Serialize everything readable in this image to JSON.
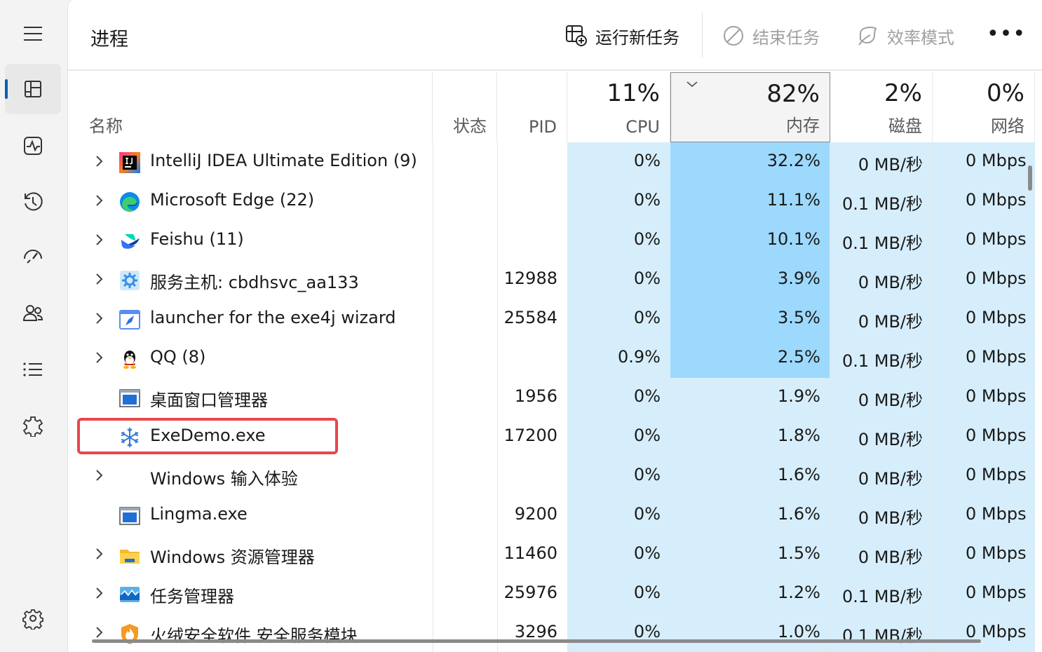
{
  "header": {
    "title": "进程",
    "run_task": "运行新任务",
    "end_task": "结束任务",
    "efficiency": "效率模式",
    "more": "•••"
  },
  "columns": {
    "name": "名称",
    "status": "状态",
    "pid": "PID",
    "cpu": {
      "pct": "11%",
      "label": "CPU"
    },
    "memory": {
      "pct": "82%",
      "label": "内存"
    },
    "disk": {
      "pct": "2%",
      "label": "磁盘"
    },
    "network": {
      "pct": "0%",
      "label": "网络"
    }
  },
  "nav_icons": [
    "menu-icon",
    "processes-icon",
    "performance-icon",
    "app-history-icon",
    "startup-apps-icon",
    "users-icon",
    "details-icon",
    "services-icon",
    "settings-icon"
  ],
  "rows": [
    {
      "name": "IntelliJ IDEA Ultimate Edition (9)",
      "pid": "",
      "cpu": "0%",
      "mem": "32.2%",
      "disk": "0 MB/秒",
      "net": "0 Mbps",
      "expand": true,
      "icon": "intellij-icon",
      "mem_level": "high"
    },
    {
      "name": "Microsoft Edge (22)",
      "pid": "",
      "cpu": "0%",
      "mem": "11.1%",
      "disk": "0.1 MB/秒",
      "net": "0 Mbps",
      "expand": true,
      "icon": "edge-icon",
      "mem_level": "high"
    },
    {
      "name": "Feishu (11)",
      "pid": "",
      "cpu": "0%",
      "mem": "10.1%",
      "disk": "0.1 MB/秒",
      "net": "0 Mbps",
      "expand": true,
      "icon": "feishu-icon",
      "mem_level": "high"
    },
    {
      "name": "服务主机: cbdhsvc_aa133",
      "pid": "12988",
      "cpu": "0%",
      "mem": "3.9%",
      "disk": "0 MB/秒",
      "net": "0 Mbps",
      "expand": true,
      "icon": "service-host-icon",
      "mem_level": "high"
    },
    {
      "name": "launcher for the exe4j wizard",
      "pid": "25584",
      "cpu": "0%",
      "mem": "3.5%",
      "disk": "0 MB/秒",
      "net": "0 Mbps",
      "expand": true,
      "icon": "launcher-icon",
      "mem_level": "high"
    },
    {
      "name": "QQ (8)",
      "pid": "",
      "cpu": "0.9%",
      "mem": "2.5%",
      "disk": "0.1 MB/秒",
      "net": "0 Mbps",
      "expand": true,
      "icon": "qq-icon",
      "mem_level": "high"
    },
    {
      "name": "桌面窗口管理器",
      "pid": "1956",
      "cpu": "0%",
      "mem": "1.9%",
      "disk": "0 MB/秒",
      "net": "0 Mbps",
      "expand": false,
      "icon": "window-icon",
      "mem_level": "low"
    },
    {
      "name": "ExeDemo.exe",
      "pid": "17200",
      "cpu": "0%",
      "mem": "1.8%",
      "disk": "0 MB/秒",
      "net": "0 Mbps",
      "expand": false,
      "icon": "snowflake-icon",
      "mem_level": "low"
    },
    {
      "name": "Windows 输入体验",
      "pid": "",
      "cpu": "0%",
      "mem": "1.6%",
      "disk": "0 MB/秒",
      "net": "0 Mbps",
      "expand": true,
      "icon": "",
      "mem_level": "low"
    },
    {
      "name": "Lingma.exe",
      "pid": "9200",
      "cpu": "0%",
      "mem": "1.6%",
      "disk": "0 MB/秒",
      "net": "0 Mbps",
      "expand": false,
      "icon": "window-icon",
      "mem_level": "low"
    },
    {
      "name": "Windows 资源管理器",
      "pid": "11460",
      "cpu": "0%",
      "mem": "1.5%",
      "disk": "0 MB/秒",
      "net": "0 Mbps",
      "expand": true,
      "icon": "folder-icon",
      "mem_level": "low"
    },
    {
      "name": "任务管理器",
      "pid": "25976",
      "cpu": "0%",
      "mem": "1.2%",
      "disk": "0.1 MB/秒",
      "net": "0 Mbps",
      "expand": true,
      "icon": "task-manager-icon",
      "mem_level": "low"
    },
    {
      "name": "火绒安全软件 安全服务模块",
      "pid": "3296",
      "cpu": "0%",
      "mem": "1.0%",
      "disk": "0.1 MB/秒",
      "net": "0 Mbps",
      "expand": true,
      "icon": "huorong-icon",
      "mem_level": "low"
    }
  ],
  "colors": {
    "accent": "#005fb8",
    "heat_light": "#d6eefb",
    "heat_strong": "#9dd9fd",
    "highlight": "#e8474b"
  }
}
